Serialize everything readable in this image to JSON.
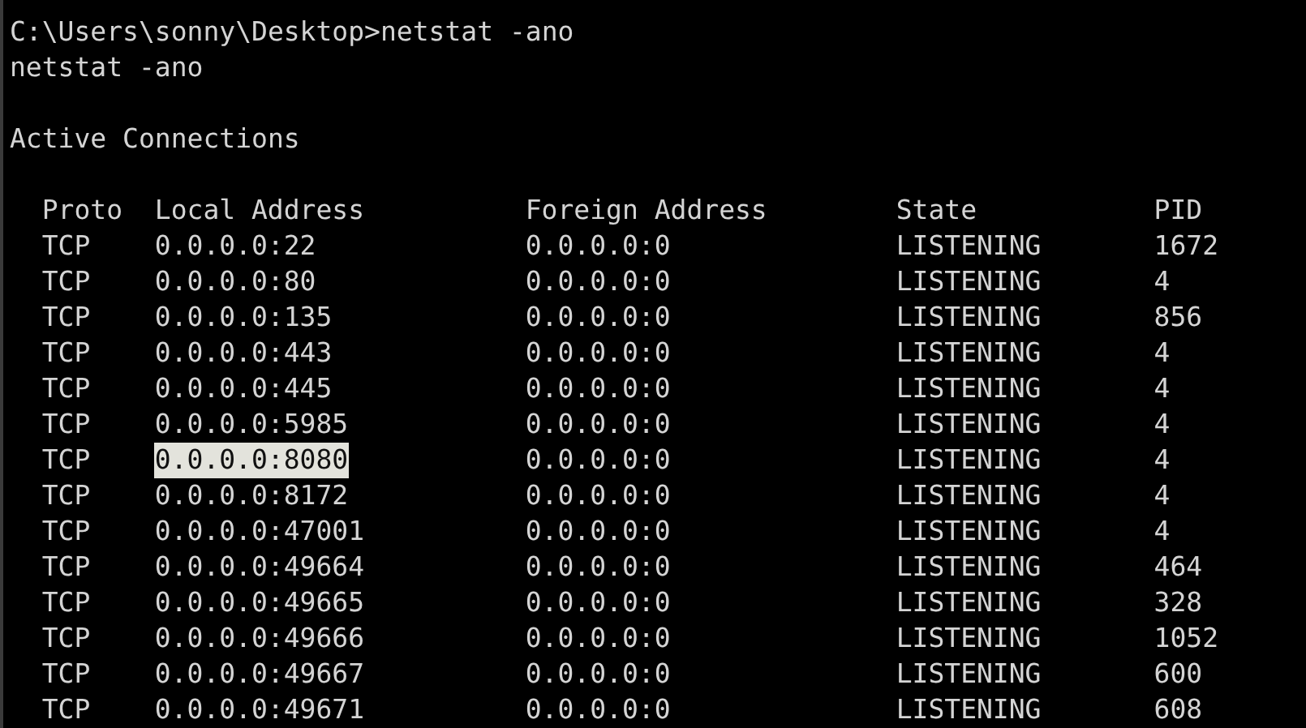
{
  "prompt_line": "C:\\Users\\sonny\\Desktop>netstat -ano",
  "echo_line": "netstat -ano",
  "section_title": "Active Connections",
  "columns": [
    "Proto",
    "Local Address",
    "Foreign Address",
    "State",
    "PID"
  ],
  "rows": [
    {
      "proto": "TCP",
      "local_address": "0.0.0.0:22",
      "foreign_address": "0.0.0.0:0",
      "state": "LISTENING",
      "pid": "1672",
      "highlighted": false
    },
    {
      "proto": "TCP",
      "local_address": "0.0.0.0:80",
      "foreign_address": "0.0.0.0:0",
      "state": "LISTENING",
      "pid": "4",
      "highlighted": false
    },
    {
      "proto": "TCP",
      "local_address": "0.0.0.0:135",
      "foreign_address": "0.0.0.0:0",
      "state": "LISTENING",
      "pid": "856",
      "highlighted": false
    },
    {
      "proto": "TCP",
      "local_address": "0.0.0.0:443",
      "foreign_address": "0.0.0.0:0",
      "state": "LISTENING",
      "pid": "4",
      "highlighted": false
    },
    {
      "proto": "TCP",
      "local_address": "0.0.0.0:445",
      "foreign_address": "0.0.0.0:0",
      "state": "LISTENING",
      "pid": "4",
      "highlighted": false
    },
    {
      "proto": "TCP",
      "local_address": "0.0.0.0:5985",
      "foreign_address": "0.0.0.0:0",
      "state": "LISTENING",
      "pid": "4",
      "highlighted": false
    },
    {
      "proto": "TCP",
      "local_address": "0.0.0.0:8080",
      "foreign_address": "0.0.0.0:0",
      "state": "LISTENING",
      "pid": "4",
      "highlighted": true
    },
    {
      "proto": "TCP",
      "local_address": "0.0.0.0:8172",
      "foreign_address": "0.0.0.0:0",
      "state": "LISTENING",
      "pid": "4",
      "highlighted": false
    },
    {
      "proto": "TCP",
      "local_address": "0.0.0.0:47001",
      "foreign_address": "0.0.0.0:0",
      "state": "LISTENING",
      "pid": "4",
      "highlighted": false
    },
    {
      "proto": "TCP",
      "local_address": "0.0.0.0:49664",
      "foreign_address": "0.0.0.0:0",
      "state": "LISTENING",
      "pid": "464",
      "highlighted": false
    },
    {
      "proto": "TCP",
      "local_address": "0.0.0.0:49665",
      "foreign_address": "0.0.0.0:0",
      "state": "LISTENING",
      "pid": "328",
      "highlighted": false
    },
    {
      "proto": "TCP",
      "local_address": "0.0.0.0:49666",
      "foreign_address": "0.0.0.0:0",
      "state": "LISTENING",
      "pid": "1052",
      "highlighted": false
    },
    {
      "proto": "TCP",
      "local_address": "0.0.0.0:49667",
      "foreign_address": "0.0.0.0:0",
      "state": "LISTENING",
      "pid": "600",
      "highlighted": false
    },
    {
      "proto": "TCP",
      "local_address": "0.0.0.0:49671",
      "foreign_address": "0.0.0.0:0",
      "state": "LISTENING",
      "pid": "608",
      "highlighted": false
    }
  ]
}
